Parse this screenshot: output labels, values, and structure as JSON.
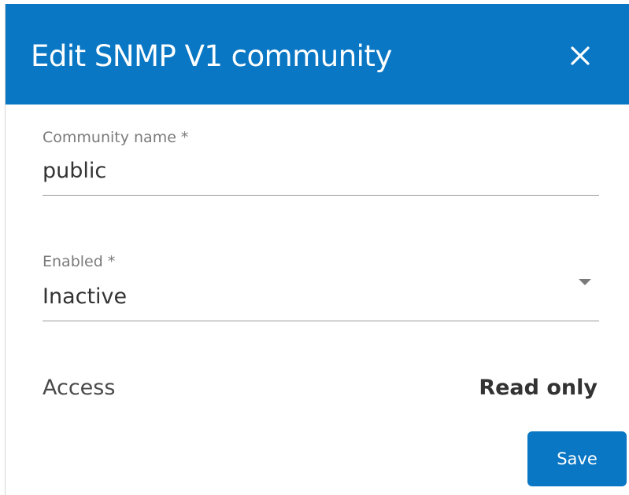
{
  "dialog": {
    "title": "Edit SNMP V1 community",
    "close_icon": "close-icon"
  },
  "fields": {
    "community_name": {
      "label": "Community name *",
      "value": "public"
    },
    "enabled": {
      "label": "Enabled *",
      "value": "Inactive",
      "arrow_icon": "dropdown-arrow-icon"
    }
  },
  "access": {
    "label": "Access",
    "value": "Read only"
  },
  "footer": {
    "save_label": "Save"
  },
  "colors": {
    "accent": "#0a77c4",
    "header_text": "#ffffff",
    "label_text": "#7a7a7a",
    "value_text": "#333333"
  }
}
